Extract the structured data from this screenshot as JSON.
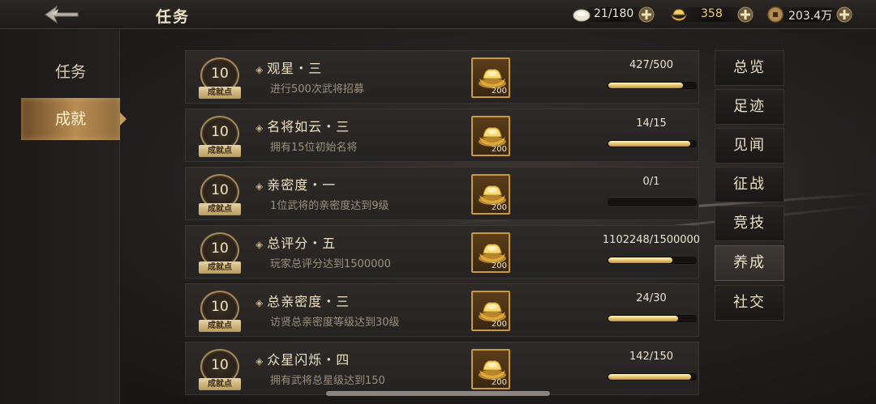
{
  "header": {
    "title": "任务",
    "resources": [
      {
        "icon": "silver-coin-icon",
        "value": "21/180"
      },
      {
        "icon": "gold-ingot-icon",
        "value": "358"
      },
      {
        "icon": "copper-coin-icon",
        "value": "203.4万"
      }
    ]
  },
  "sidebar": {
    "items": [
      {
        "label": "任务"
      },
      {
        "label": "成就",
        "active": true
      }
    ]
  },
  "tasks": [
    {
      "points": "10",
      "points_label": "成就点",
      "name": "观星・三",
      "desc": "进行500次武将招募",
      "reward_qty": "200",
      "progress_text": "427/500",
      "progress": 0.854
    },
    {
      "points": "10",
      "points_label": "成就点",
      "name": "名将如云・三",
      "desc": "拥有15位初始名将",
      "reward_qty": "200",
      "progress_text": "14/15",
      "progress": 0.933
    },
    {
      "points": "10",
      "points_label": "成就点",
      "name": "亲密度・一",
      "desc": "1位武将的亲密度达到9级",
      "reward_qty": "200",
      "progress_text": "0/1",
      "progress": 0
    },
    {
      "points": "10",
      "points_label": "成就点",
      "name": "总评分・五",
      "desc": "玩家总评分达到1500000",
      "reward_qty": "200",
      "progress_text": "1102248/1500000",
      "progress": 0.735
    },
    {
      "points": "10",
      "points_label": "成就点",
      "name": "总亲密度・三",
      "desc": "访贤总亲密度等级达到30级",
      "reward_qty": "200",
      "progress_text": "24/30",
      "progress": 0.8
    },
    {
      "points": "10",
      "points_label": "成就点",
      "name": "众星闪烁・四",
      "desc": "拥有武将总星级达到150",
      "reward_qty": "200",
      "progress_text": "142/150",
      "progress": 0.947
    }
  ],
  "categories": [
    {
      "label": "总览"
    },
    {
      "label": "足迹"
    },
    {
      "label": "见闻"
    },
    {
      "label": "征战"
    },
    {
      "label": "竞技"
    },
    {
      "label": "养成",
      "active": true
    },
    {
      "label": "社交"
    }
  ],
  "colors": {
    "accent_gold": "#e6c670",
    "background": "#232120",
    "text_primary": "#efe2c2"
  }
}
